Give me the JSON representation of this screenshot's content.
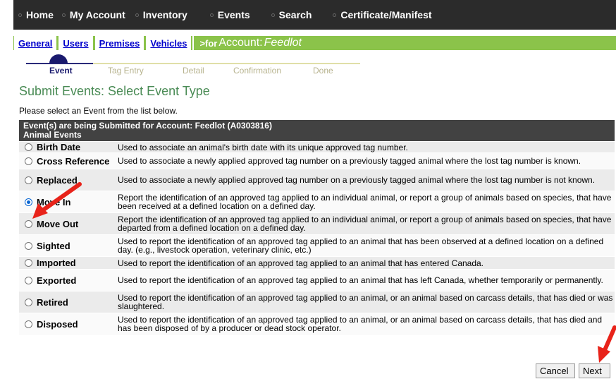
{
  "topnav": {
    "items": [
      "Home",
      "My Account",
      "Inventory",
      "Events",
      "Search",
      "Certificate/Manifest"
    ]
  },
  "subnav": {
    "tabs": [
      "General",
      "Users",
      "Premises",
      "Vehicles"
    ],
    "for_prefix": ">for",
    "account_label": "Account:",
    "account_name": "Feedlot"
  },
  "steps": {
    "labels": [
      "Event",
      "Tag Entry",
      "Detail",
      "Confirmation",
      "Done"
    ],
    "active_index": 0
  },
  "page_title": "Submit Events: Select Event Type",
  "instruction": "Please select an Event from the list below.",
  "table": {
    "header_line1": "Event(s) are being Submitted for Account: Feedlot (A0303816)",
    "header_line2": "Animal Events",
    "rows": [
      {
        "name": "Birth Date",
        "selected": false,
        "desc": "Used to associate an animal's birth date with its unique approved tag number."
      },
      {
        "name": "Cross Reference",
        "selected": false,
        "desc": "Used to associate a newly applied approved tag number on a previously tagged animal where the lost tag number is known."
      },
      {
        "name": "Replaced",
        "selected": false,
        "desc": "Used to associate a newly applied approved tag number on a previously tagged animal where the lost tag number is not known."
      },
      {
        "name": "Move In",
        "selected": true,
        "desc": "Report the identification of an approved tag applied to an individual animal, or report a group of animals based on species, that have been received at a defined location on a defined day."
      },
      {
        "name": "Move Out",
        "selected": false,
        "desc": "Report the identification of an approved tag applied to an individual animal, or report a group of animals based on species, that have departed from a defined location on a defined day."
      },
      {
        "name": "Sighted",
        "selected": false,
        "desc": "Used to report the identification of an approved tag applied to an animal that has been observed at a defined location on a defined day. (e.g., livestock operation, veterinary clinic, etc.)"
      },
      {
        "name": "Imported",
        "selected": false,
        "desc": "Used to report the identification of an approved tag applied to an animal that has entered Canada."
      },
      {
        "name": "Exported",
        "selected": false,
        "desc": "Used to report the identification of an approved tag applied to an animal that has left Canada, whether temporarily or permanently."
      },
      {
        "name": "Retired",
        "selected": false,
        "desc": "Used to report the identification of an approved tag applied to an animal, or an animal based on carcass details, that has died or was slaughtered."
      },
      {
        "name": "Disposed",
        "selected": false,
        "desc": "Used to report the identification of an approved tag applied to an animal, or an animal based on carcass details, that has died and has been disposed of by a producer or dead stock operator."
      }
    ]
  },
  "buttons": {
    "cancel": "Cancel",
    "next": "Next"
  },
  "colors": {
    "topnav_bg": "#2b2b2b",
    "subnav_bg": "#8bc34a",
    "title_green": "#4a8b55",
    "table_header": "#424242",
    "annotation_arrow": "#e8231a"
  }
}
